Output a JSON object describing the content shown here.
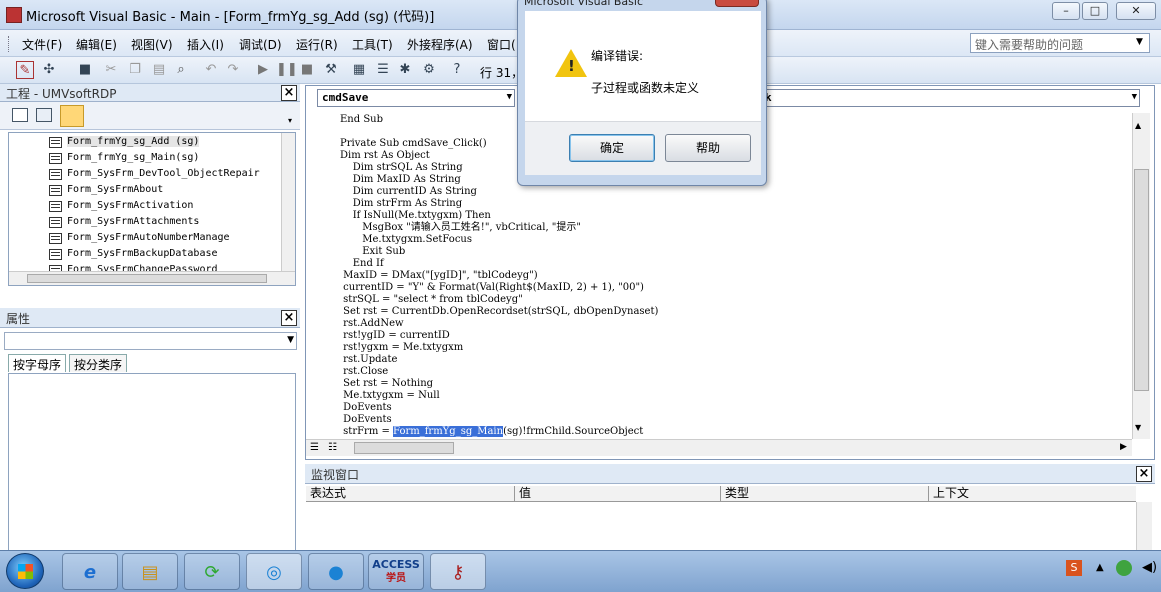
{
  "window": {
    "title": "Microsoft Visual Basic - Main - [Form_frmYg_sg_Add (sg) (代码)]",
    "min": "–",
    "max": "□",
    "close": "✕"
  },
  "menu": {
    "items": [
      "文件(F)",
      "编辑(E)",
      "视图(V)",
      "插入(I)",
      "调试(D)",
      "运行(R)",
      "工具(T)",
      "外接程序(A)",
      "窗口("
    ],
    "help_placeholder": "键入需要帮助的问题"
  },
  "toolbar": {
    "position": "行 31，"
  },
  "project": {
    "title": "工程 - UMVsoftRDP",
    "items": [
      "Form_frmYg_sg_Add (sg)",
      "Form_frmYg_sg_Main(sg)",
      "Form_SysFrm_DevTool_ObjectRepair",
      "Form_SysFrmAbout",
      "Form_SysFrmActivation",
      "Form_SysFrmAttachments",
      "Form_SysFrmAutoNumberManage",
      "Form_SysFrmBackupDatabase",
      "Form_SysFrmChangePassword"
    ]
  },
  "properties": {
    "title": "属性",
    "tab_alpha": "按字母序",
    "tab_category": "按分类序"
  },
  "code": {
    "object_combo": "cmdSave",
    "proc_combo": "k",
    "lines": [
      "End Sub",
      "",
      "Private Sub cmdSave_Click()",
      "Dim rst As Object",
      "    Dim strSQL As String",
      "    Dim MaxID As String",
      "    Dim currentID As String",
      "    Dim strFrm As String",
      "    If IsNull(Me.txtygxm) Then",
      "       MsgBox \"请输入员工姓名!\", vbCritical, \"提示\"",
      "       Me.txtygxm.SetFocus",
      "       Exit Sub",
      "    End If",
      " MaxID = DMax(\"[ygID]\", \"tblCodeyg\")",
      " currentID = \"Y\" & Format(Val(Right$(MaxID, 2) + 1), \"00\")",
      " strSQL = \"select * from tblCodeyg\"",
      " Set rst = CurrentDb.OpenRecordset(strSQL, dbOpenDynaset)",
      " rst.AddNew",
      " rst!ygID = currentID",
      " rst!ygxm = Me.txtygxm",
      " rst.Update",
      " rst.Close",
      " Set rst = Nothing",
      " Me.txtygxm = Null",
      " DoEvents",
      " DoEvents"
    ],
    "last_line_prefix": " strFrm = ",
    "last_line_selected": "Form_frmYg_sg_Main",
    "last_line_suffix": "(sg)!frmChild.SourceObject"
  },
  "watch": {
    "title": "监视窗口",
    "columns": [
      "表达式",
      "值",
      "类型",
      "上下文"
    ]
  },
  "dialog": {
    "title": "Microsoft Visual Basic",
    "heading": "编译错误:",
    "message": "子过程或函数未定义",
    "ok": "确定",
    "help": "帮助"
  },
  "taskbar": {
    "apps": [
      "ie-icon",
      "explorer-icon",
      "refresh-icon",
      "browser-icon",
      "qq-icon",
      "access-icon",
      "vba-icon"
    ],
    "access_label": "ACCESS",
    "access_sub": "学员"
  }
}
